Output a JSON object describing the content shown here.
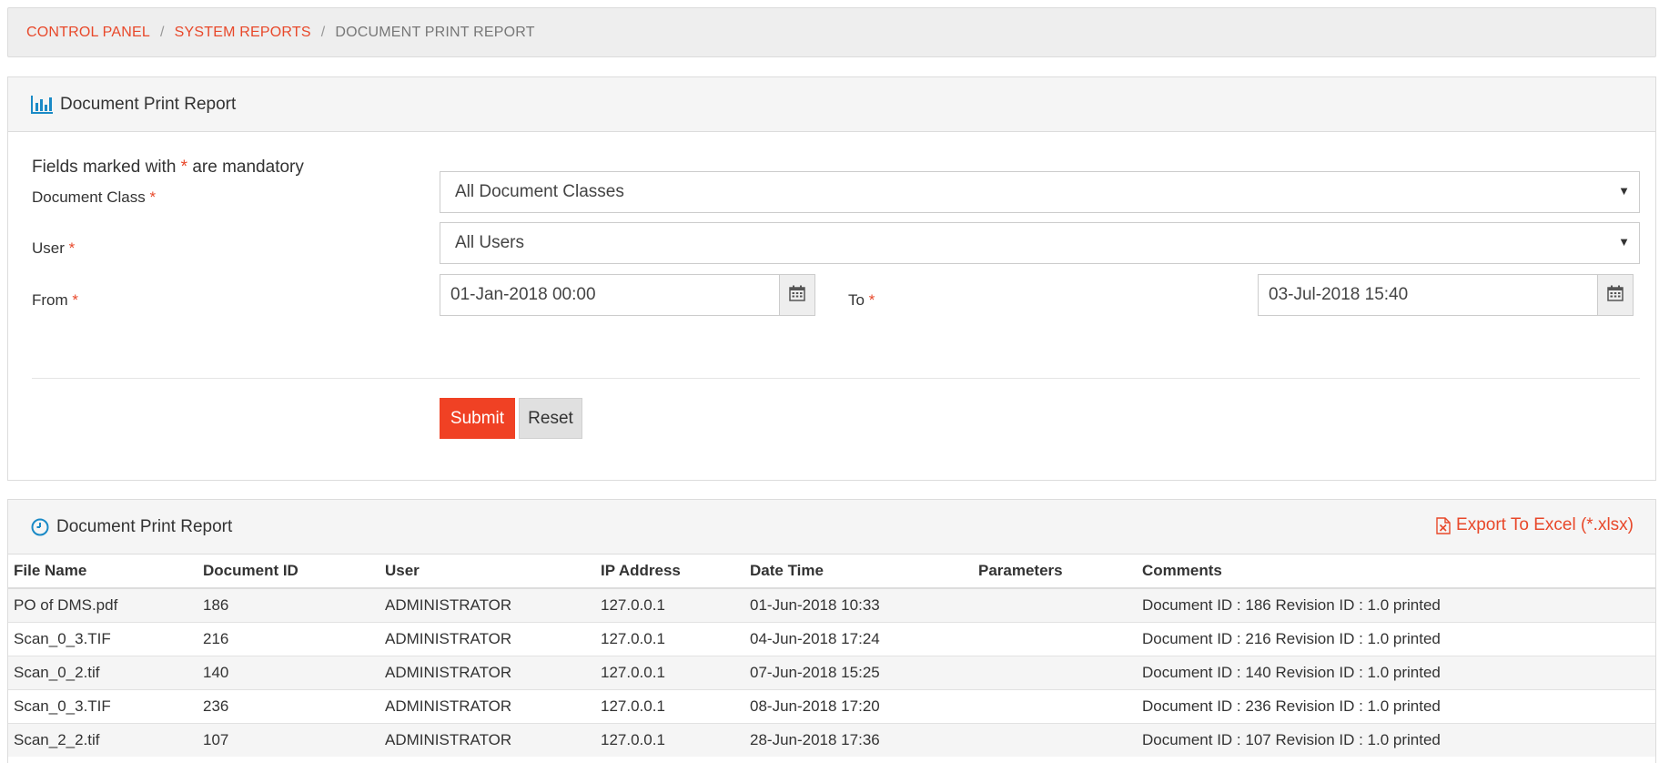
{
  "breadcrumb": {
    "items": [
      "CONTROL PANEL",
      "SYSTEM REPORTS"
    ],
    "current": "DOCUMENT PRINT REPORT",
    "separator": "/"
  },
  "form_panel": {
    "title": "Document Print Report",
    "icon": "bar-chart-icon",
    "mandatory_prefix": "Fields marked with",
    "mandatory_star": "*",
    "mandatory_suffix": "are mandatory",
    "document_class": {
      "label": "Document Class",
      "value": "All Document Classes"
    },
    "user": {
      "label": "User",
      "value": "All Users"
    },
    "from": {
      "label": "From",
      "value": "01-Jan-2018 00:00"
    },
    "to": {
      "label": "To",
      "value": "03-Jul-2018 15:40"
    },
    "submit_label": "Submit",
    "reset_label": "Reset"
  },
  "results_panel": {
    "title": "Document Print Report",
    "icon": "clock-icon",
    "export_label": "Export To Excel (*.xlsx)",
    "columns": [
      "File Name",
      "Document ID",
      "User",
      "IP Address",
      "Date Time",
      "Parameters",
      "Comments"
    ],
    "rows": [
      [
        "PO of DMS.pdf",
        "186",
        "ADMINISTRATOR",
        "127.0.0.1",
        "01-Jun-2018 10:33",
        "",
        "Document ID : 186 Revision ID : 1.0 printed"
      ],
      [
        "Scan_0_3.TIF",
        "216",
        "ADMINISTRATOR",
        "127.0.0.1",
        "04-Jun-2018 17:24",
        "",
        "Document ID : 216 Revision ID : 1.0 printed"
      ],
      [
        "Scan_0_2.tif",
        "140",
        "ADMINISTRATOR",
        "127.0.0.1",
        "07-Jun-2018 15:25",
        "",
        "Document ID : 140 Revision ID : 1.0 printed"
      ],
      [
        "Scan_0_3.TIF",
        "236",
        "ADMINISTRATOR",
        "127.0.0.1",
        "08-Jun-2018 17:20",
        "",
        "Document ID : 236 Revision ID : 1.0 printed"
      ],
      [
        "Scan_2_2.tif",
        "107",
        "ADMINISTRATOR",
        "127.0.0.1",
        "28-Jun-2018 17:36",
        "",
        "Document ID : 107 Revision ID : 1.0 printed"
      ]
    ]
  },
  "colors": {
    "accent": "#e8482a",
    "submit_bg": "#f04124",
    "icon_blue": "#1a8ac6"
  }
}
